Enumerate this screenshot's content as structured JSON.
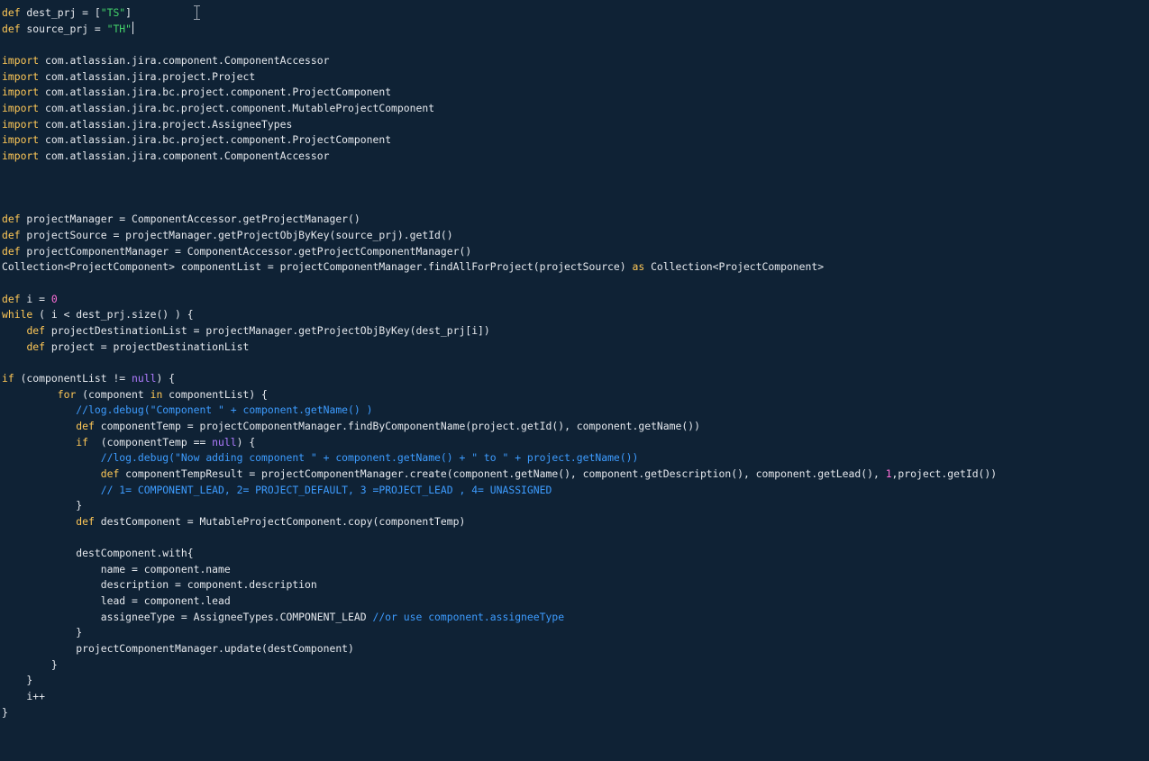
{
  "editor": {
    "lines": [
      [
        [
          "kw",
          "def"
        ],
        [
          "plain",
          " dest_prj = ["
        ],
        [
          "str",
          "\"TS\""
        ],
        [
          "plain",
          "]"
        ]
      ],
      [
        [
          "kw",
          "def"
        ],
        [
          "plain",
          " source_prj = "
        ],
        [
          "str",
          "\"TH\""
        ]
      ],
      [],
      [
        [
          "kw",
          "import"
        ],
        [
          "plain",
          " com.atlassian.jira.component.ComponentAccessor"
        ]
      ],
      [
        [
          "kw",
          "import"
        ],
        [
          "plain",
          " com.atlassian.jira.project.Project"
        ]
      ],
      [
        [
          "kw",
          "import"
        ],
        [
          "plain",
          " com.atlassian.jira.bc.project.component.ProjectComponent"
        ]
      ],
      [
        [
          "kw",
          "import"
        ],
        [
          "plain",
          " com.atlassian.jira.bc.project.component.MutableProjectComponent"
        ]
      ],
      [
        [
          "kw",
          "import"
        ],
        [
          "plain",
          " com.atlassian.jira.project.AssigneeTypes"
        ]
      ],
      [
        [
          "kw",
          "import"
        ],
        [
          "plain",
          " com.atlassian.jira.bc.project.component.ProjectComponent"
        ]
      ],
      [
        [
          "kw",
          "import"
        ],
        [
          "plain",
          " com.atlassian.jira.component.ComponentAccessor"
        ]
      ],
      [],
      [],
      [],
      [
        [
          "kw",
          "def"
        ],
        [
          "plain",
          " projectManager = ComponentAccessor.getProjectManager()"
        ]
      ],
      [
        [
          "kw",
          "def"
        ],
        [
          "plain",
          " projectSource = projectManager.getProjectObjByKey(source_prj).getId()"
        ]
      ],
      [
        [
          "kw",
          "def"
        ],
        [
          "plain",
          " projectComponentManager = ComponentAccessor.getProjectComponentManager()"
        ]
      ],
      [
        [
          "plain",
          "Collection<ProjectComponent> componentList = projectComponentManager.findAllForProject(projectSource) "
        ],
        [
          "kw",
          "as"
        ],
        [
          "plain",
          " Collection<ProjectComponent>"
        ]
      ],
      [],
      [
        [
          "kw",
          "def"
        ],
        [
          "plain",
          " i = "
        ],
        [
          "num",
          "0"
        ]
      ],
      [
        [
          "kw",
          "while"
        ],
        [
          "plain",
          " ( i < dest_prj.size() ) {"
        ]
      ],
      [
        [
          "plain",
          "    "
        ],
        [
          "kw",
          "def"
        ],
        [
          "plain",
          " projectDestinationList = projectManager.getProjectObjByKey(dest_prj[i])"
        ]
      ],
      [
        [
          "plain",
          "    "
        ],
        [
          "kw",
          "def"
        ],
        [
          "plain",
          " project = projectDestinationList"
        ]
      ],
      [],
      [
        [
          "kw",
          "if"
        ],
        [
          "plain",
          " (componentList != "
        ],
        [
          "null",
          "null"
        ],
        [
          "plain",
          ") {"
        ]
      ],
      [
        [
          "plain",
          "         "
        ],
        [
          "kw",
          "for"
        ],
        [
          "plain",
          " (component "
        ],
        [
          "kw",
          "in"
        ],
        [
          "plain",
          " componentList) {"
        ]
      ],
      [
        [
          "plain",
          "            "
        ],
        [
          "com",
          "//log.debug(\"Component \" + component.getName() )"
        ]
      ],
      [
        [
          "plain",
          "            "
        ],
        [
          "kw",
          "def"
        ],
        [
          "plain",
          " componentTemp = projectComponentManager.findByComponentName(project.getId(), component.getName())"
        ]
      ],
      [
        [
          "plain",
          "            "
        ],
        [
          "kw",
          "if"
        ],
        [
          "plain",
          "  (componentTemp == "
        ],
        [
          "null",
          "null"
        ],
        [
          "plain",
          ") {"
        ]
      ],
      [
        [
          "plain",
          "                "
        ],
        [
          "com",
          "//log.debug(\"Now adding component \" + component.getName() + \" to \" + project.getName())"
        ]
      ],
      [
        [
          "plain",
          "                "
        ],
        [
          "kw",
          "def"
        ],
        [
          "plain",
          " componentTempResult = projectComponentManager.create(component.getName(), component.getDescription(), component.getLead(), "
        ],
        [
          "num",
          "1"
        ],
        [
          "plain",
          ",project.getId())"
        ]
      ],
      [
        [
          "plain",
          "                "
        ],
        [
          "com",
          "// 1= COMPONENT_LEAD, 2= PROJECT_DEFAULT, 3 =PROJECT_LEAD , 4= UNASSIGNED"
        ]
      ],
      [
        [
          "plain",
          "            }"
        ]
      ],
      [
        [
          "plain",
          "            "
        ],
        [
          "kw",
          "def"
        ],
        [
          "plain",
          " destComponent = MutableProjectComponent.copy(componentTemp)"
        ]
      ],
      [],
      [
        [
          "plain",
          "            destComponent.with{"
        ]
      ],
      [
        [
          "plain",
          "                name = component.name"
        ]
      ],
      [
        [
          "plain",
          "                description = component.description"
        ]
      ],
      [
        [
          "plain",
          "                lead = component.lead"
        ]
      ],
      [
        [
          "plain",
          "                assigneeType = AssigneeTypes.COMPONENT_LEAD "
        ],
        [
          "com",
          "//or use component.assigneeType"
        ]
      ],
      [
        [
          "plain",
          "            }"
        ]
      ],
      [
        [
          "plain",
          "            projectComponentManager.update(destComponent)"
        ]
      ],
      [
        [
          "plain",
          "        }"
        ]
      ],
      [
        [
          "plain",
          "    }"
        ]
      ],
      [
        [
          "plain",
          "    i++"
        ]
      ],
      [
        [
          "plain",
          "}"
        ]
      ]
    ]
  }
}
